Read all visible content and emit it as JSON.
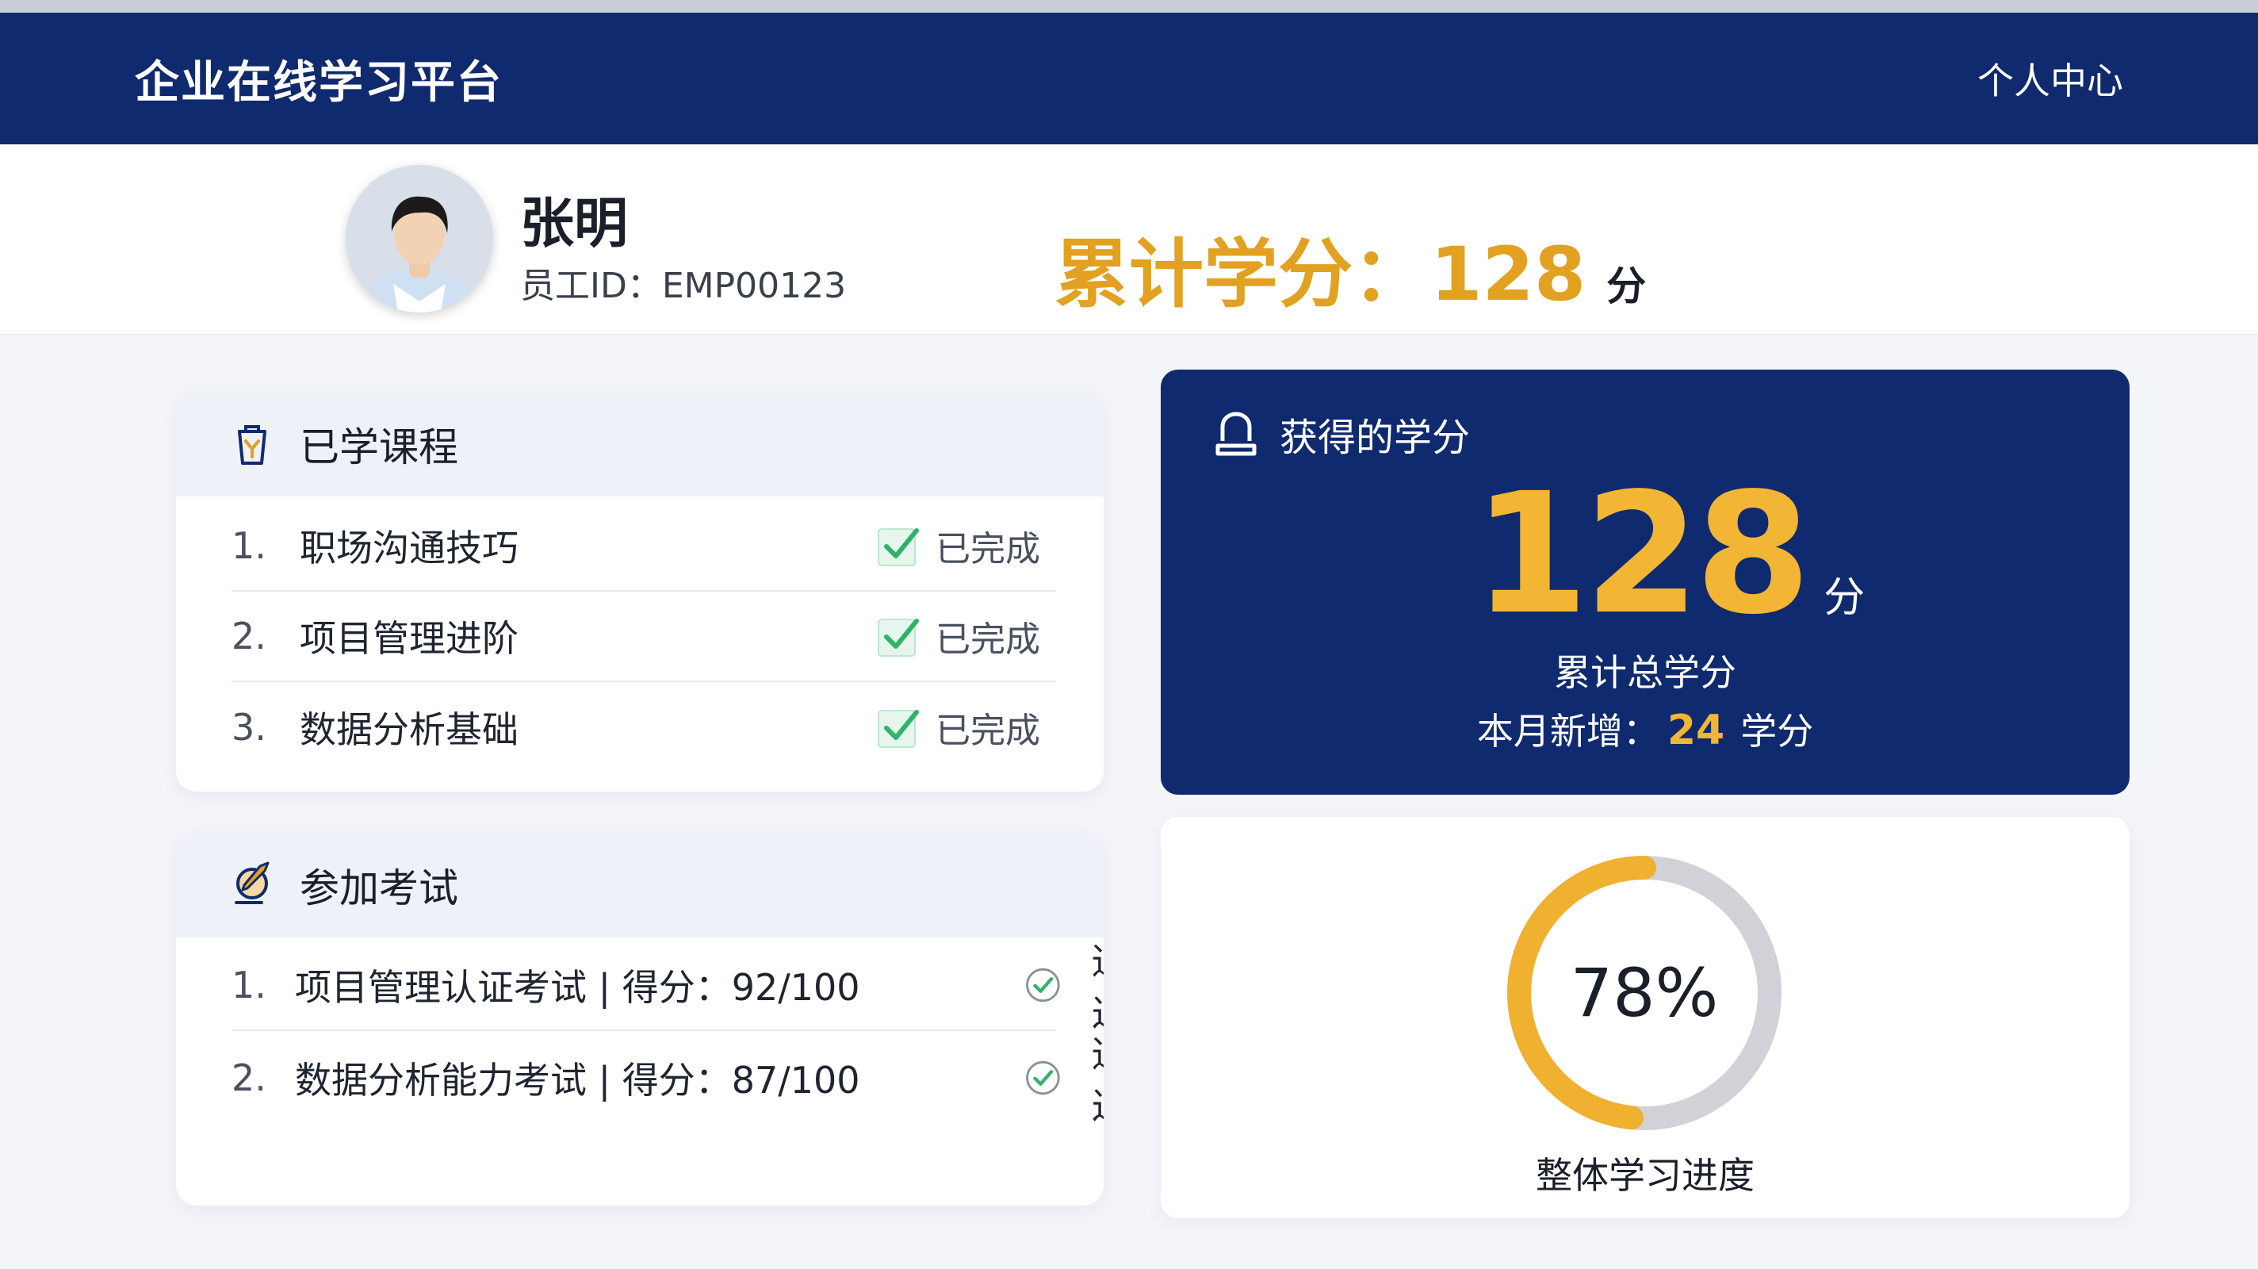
{
  "header": {
    "app_title": "企业在线学习平台",
    "personal_center": "个人中心"
  },
  "profile": {
    "name": "张明",
    "employee_id": "员工ID：EMP00123",
    "credits_label": "累计学分：",
    "credits_value": "128",
    "credits_unit": "分"
  },
  "courses": {
    "title": "已学课程",
    "items": [
      {
        "index": "1.",
        "name": "职场沟通技巧",
        "status": "已完成"
      },
      {
        "index": "2.",
        "name": "项目管理进阶",
        "status": "已完成"
      },
      {
        "index": "3.",
        "name": "数据分析基础",
        "status": "已完成"
      }
    ]
  },
  "exams": {
    "title": "参加考试",
    "items": [
      {
        "index": "1.",
        "text": "项目管理认证考试 | 得分：92/100",
        "result": "通过"
      },
      {
        "index": "2.",
        "text": "数据分析能力考试 | 得分：87/100",
        "result": "通过"
      }
    ]
  },
  "credits_card": {
    "title": "获得的学分",
    "value": "128",
    "unit": "分",
    "total_label": "累计总学分",
    "month_label": "本月新增：",
    "month_value": "24",
    "month_unit": "学分"
  },
  "progress": {
    "percent": 78,
    "percent_text": "78%",
    "caption": "整体学习进度"
  },
  "colors": {
    "brand_navy": "#0f2a6e",
    "accent_gold": "#e2a121",
    "check_green": "#2fb36a"
  }
}
